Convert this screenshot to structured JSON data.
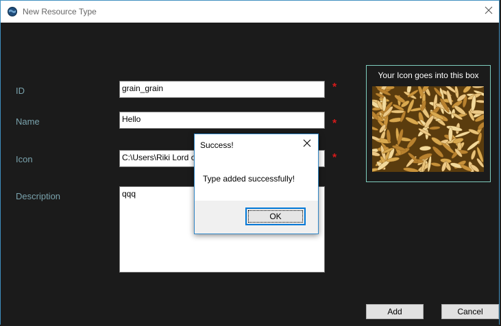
{
  "window": {
    "title": "New Resource Type"
  },
  "form": {
    "id_label": "ID",
    "id_value": "grain_grain",
    "name_label": "Name",
    "name_value": "Hello",
    "icon_label": "Icon",
    "icon_value": "C:\\Users\\Riki Lord of",
    "description_label": "Description",
    "description_value": "qqq",
    "required_mark": "*"
  },
  "icon_preview": {
    "caption": "Your Icon goes into this box"
  },
  "buttons": {
    "add": "Add",
    "cancel": "Cancel"
  },
  "dialog": {
    "title": "Success!",
    "message": "Type added successfully!",
    "ok": "OK"
  },
  "colors": {
    "background": "#1b1b1b",
    "label": "#7aa3ad",
    "required": "#d41a1a",
    "icon_box_border": "#7fcfc0",
    "accent": "#0078d7"
  },
  "icons": {
    "app": "globe-icon",
    "close": "close-icon",
    "preview": "grain-image"
  }
}
